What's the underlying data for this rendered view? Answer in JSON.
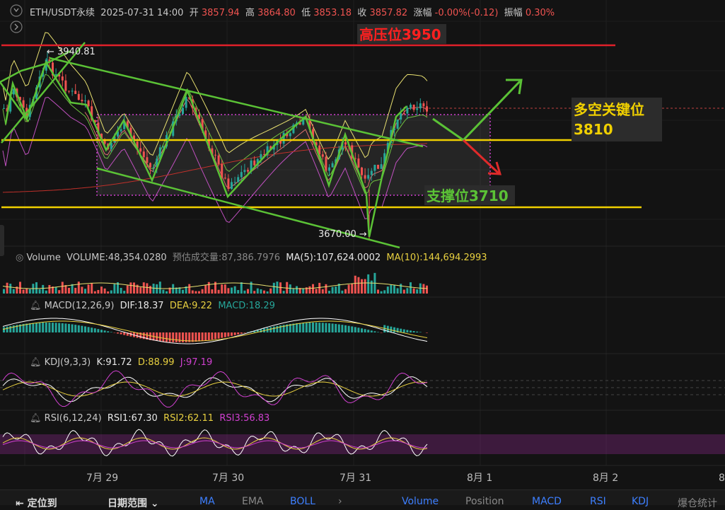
{
  "header": {
    "symbol": "ETH/USDT永续",
    "datetime": "2025-07-31 14:00",
    "open_label": "开",
    "open": "3857.94",
    "high_label": "高",
    "high": "3864.80",
    "low_label": "低",
    "low": "3853.18",
    "close_label": "收",
    "close": "3857.82",
    "change_label": "涨幅",
    "change": "-0.00%(-0.12)",
    "amp_label": "振幅",
    "amp": "0.30%"
  },
  "annotations": {
    "resistance": "高压位3950",
    "key_level_line1": "多空关键位",
    "key_level_line2": "3810",
    "support": "支撑位3710",
    "high_marker": "← 3940.81",
    "low_marker": "3670.00 →"
  },
  "volume_panel": {
    "title": "Volume",
    "volume": "VOLUME:48,354.0280",
    "estimate": "预估成交量:87,386.7976",
    "ma5": "MA(5):107,624.0002",
    "ma10": "MA(10):144,694.2993"
  },
  "macd_panel": {
    "title": "MACD(12,26,9)",
    "dif": "DIF:18.37",
    "dea": "DEA:9.22",
    "macd": "MACD:18.29"
  },
  "kdj_panel": {
    "title": "KDJ(9,3,3)",
    "k": "K:91.72",
    "d": "D:88.99",
    "j": "J:97.19"
  },
  "rsi_panel": {
    "title": "RSI(6,12,24)",
    "rsi1": "RSI1:67.30",
    "rsi2": "RSI2:62.11",
    "rsi3": "RSI3:56.83"
  },
  "x_axis": [
    "7月 29",
    "7月 30",
    "7月 31",
    "8月 1",
    "8月 2",
    "8"
  ],
  "toolbar": {
    "locate": "定位到",
    "date_range": "日期范围",
    "items": [
      "MA",
      "EMA",
      "BOLL",
      "Volume",
      "Position",
      "MACD",
      "RSI",
      "KDJ",
      "爆仓统计"
    ]
  },
  "colors": {
    "up": "#26a69a",
    "down": "#ef5350",
    "green_line": "#5bc236",
    "yellow": "#f0d000",
    "red_line": "#e0202a"
  },
  "chart_data": {
    "type": "candlestick",
    "levels": {
      "resistance": 3950,
      "key": 3810,
      "support": 3710,
      "high": 3940.81,
      "low": 3670.0
    },
    "last": {
      "open": 3857.94,
      "high": 3864.8,
      "low": 3853.18,
      "close": 3857.82
    }
  }
}
